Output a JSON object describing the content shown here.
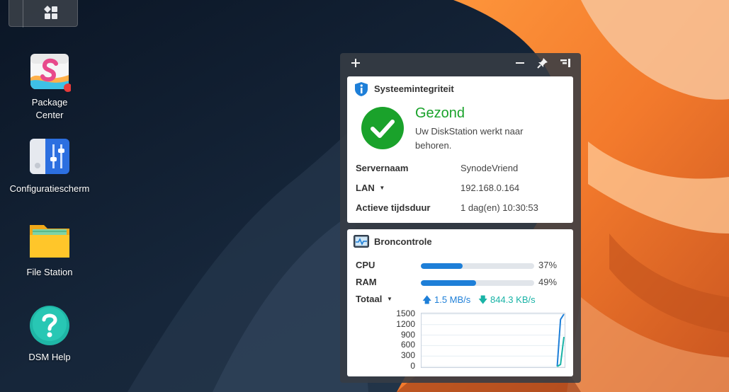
{
  "desktop": {
    "icons": [
      {
        "label": "Package\nCenter",
        "icon": "package-center-icon"
      },
      {
        "label": "Configuratiescherm",
        "icon": "control-panel-icon"
      },
      {
        "label": "File Station",
        "icon": "folder-icon"
      },
      {
        "label": "DSM Help",
        "icon": "help-icon"
      }
    ],
    "package_center_line1": "Package",
    "package_center_line2": "Center"
  },
  "widget_panel": {
    "toolbar": {
      "add": "+",
      "minimize": "−"
    },
    "system_health": {
      "title": "Systeemintegriteit",
      "status": "Gezond",
      "status_color": "#1aa22b",
      "description": "Uw DiskStation werkt naar behoren.",
      "rows": [
        {
          "key": "Servernaam",
          "value": "SynodeVriend"
        },
        {
          "key": "LAN",
          "value": "192.168.0.164"
        },
        {
          "key": "Actieve tijdsduur",
          "value": "1 dag(en) 10:30:53"
        }
      ]
    },
    "resource_monitor": {
      "title": "Broncontrole",
      "cpu": {
        "label": "CPU",
        "percent": 37,
        "text": "37%"
      },
      "ram": {
        "label": "RAM",
        "percent": 49,
        "text": "49%"
      },
      "total": {
        "label": "Totaal",
        "upload": "1.5 MB/s",
        "download": "844.3 KB/s"
      },
      "upload_color": "#1e7fd8",
      "download_color": "#19b3a6",
      "chart_data": {
        "type": "line",
        "ylim": [
          0,
          1500
        ],
        "yticks": [
          "1500",
          "1200",
          "900",
          "600",
          "300",
          "0"
        ],
        "series": [
          {
            "values": [
              0,
              0,
              0,
              0,
              0,
              0,
              0,
              0,
              0,
              0,
              0,
              0,
              0,
              0,
              0,
              0,
              0,
              0,
              0,
              0,
              0,
              0,
              0,
              0,
              0,
              0,
              0,
              0,
              0,
              0,
              0,
              0,
              0,
              0,
              0,
              0,
              0,
              0,
              0,
              0,
              0,
              1350,
              1500
            ]
          },
          {
            "values": [
              0,
              0,
              0,
              0,
              0,
              0,
              0,
              0,
              0,
              0,
              0,
              0,
              0,
              0,
              0,
              0,
              0,
              0,
              0,
              0,
              0,
              0,
              0,
              0,
              0,
              0,
              0,
              0,
              0,
              0,
              0,
              0,
              0,
              0,
              0,
              0,
              0,
              0,
              0,
              0,
              0,
              60,
              850
            ]
          }
        ]
      }
    }
  }
}
